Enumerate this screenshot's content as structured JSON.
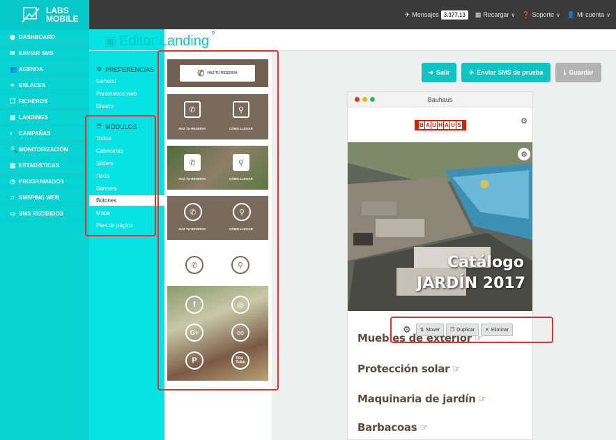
{
  "brand": {
    "line1": "LABS",
    "line2": "MOBILE"
  },
  "topnav": {
    "messages_label": "Mensajes",
    "messages_count": "3.377,13",
    "recharge_label": "Recargar",
    "support_label": "Soporte",
    "account_label": "Mi cuenta"
  },
  "sidebar": {
    "items": [
      {
        "label": "DASHBOARD",
        "icon": "dashboard-icon"
      },
      {
        "label": "ENVIAR SMS",
        "icon": "envelope-icon"
      },
      {
        "label": "AGENDA",
        "icon": "users-icon"
      },
      {
        "label": "ENLACES",
        "icon": "link-icon"
      },
      {
        "label": "FICHEROS",
        "icon": "files-icon"
      },
      {
        "label": "LANDINGS",
        "icon": "landing-icon"
      },
      {
        "label": "CAMPAÑAS",
        "icon": "campaign-icon"
      },
      {
        "label": "MONITORIZACIÓN",
        "icon": "search-icon"
      },
      {
        "label": "ESTADÍSTICAS",
        "icon": "bar-chart-icon"
      },
      {
        "label": "PROGRAMADOS",
        "icon": "clock-icon"
      },
      {
        "label": "SMSPING WEB",
        "icon": "bell-icon"
      },
      {
        "label": "SMS RECIBIDOS",
        "icon": "inbox-icon"
      }
    ]
  },
  "editor": {
    "title": "Editor Landing",
    "help": "?"
  },
  "subpanel": {
    "preferences_title": "PREFERENCIAS",
    "preferences": [
      "General",
      "Parámetros web",
      "Diseño"
    ],
    "modules_title": "MÓDULOS",
    "modules": [
      "Todos",
      "Cabeceras",
      "Sliders",
      "Texto",
      "Banners",
      "Botones",
      "Mapa",
      "Pies de página"
    ],
    "active_module": "Botones"
  },
  "modules_preview": {
    "reserve_label": "HAZ TU RESERVA",
    "arrive_label": "CÓMO LLEGAR"
  },
  "actions": {
    "exit_label": "Salir",
    "test_label": "Enviar SMS de prueba",
    "save_label": "Guardar"
  },
  "phone": {
    "title": "Bauhaus",
    "brand_letters": [
      "B",
      "A",
      "U",
      "H",
      "A",
      "U",
      "S"
    ],
    "hero_line1": "Catálogo",
    "hero_line2": "JARDÍN 2017",
    "menu": [
      "Muebles de exterior",
      "Protección solar",
      "Maquinaria de jardín",
      "Barbacoas"
    ]
  },
  "toolbar": {
    "move_label": "Mover",
    "duplicate_label": "Duplicar",
    "delete_label": "Eliminar"
  },
  "colors": {
    "accent": "#07d4d2",
    "highlight": "#e8302a",
    "brand_red": "#d81e05",
    "module_brown": "#7a6a5c",
    "button_teal": "#10c4c4",
    "button_gray": "#b3b3b3"
  }
}
